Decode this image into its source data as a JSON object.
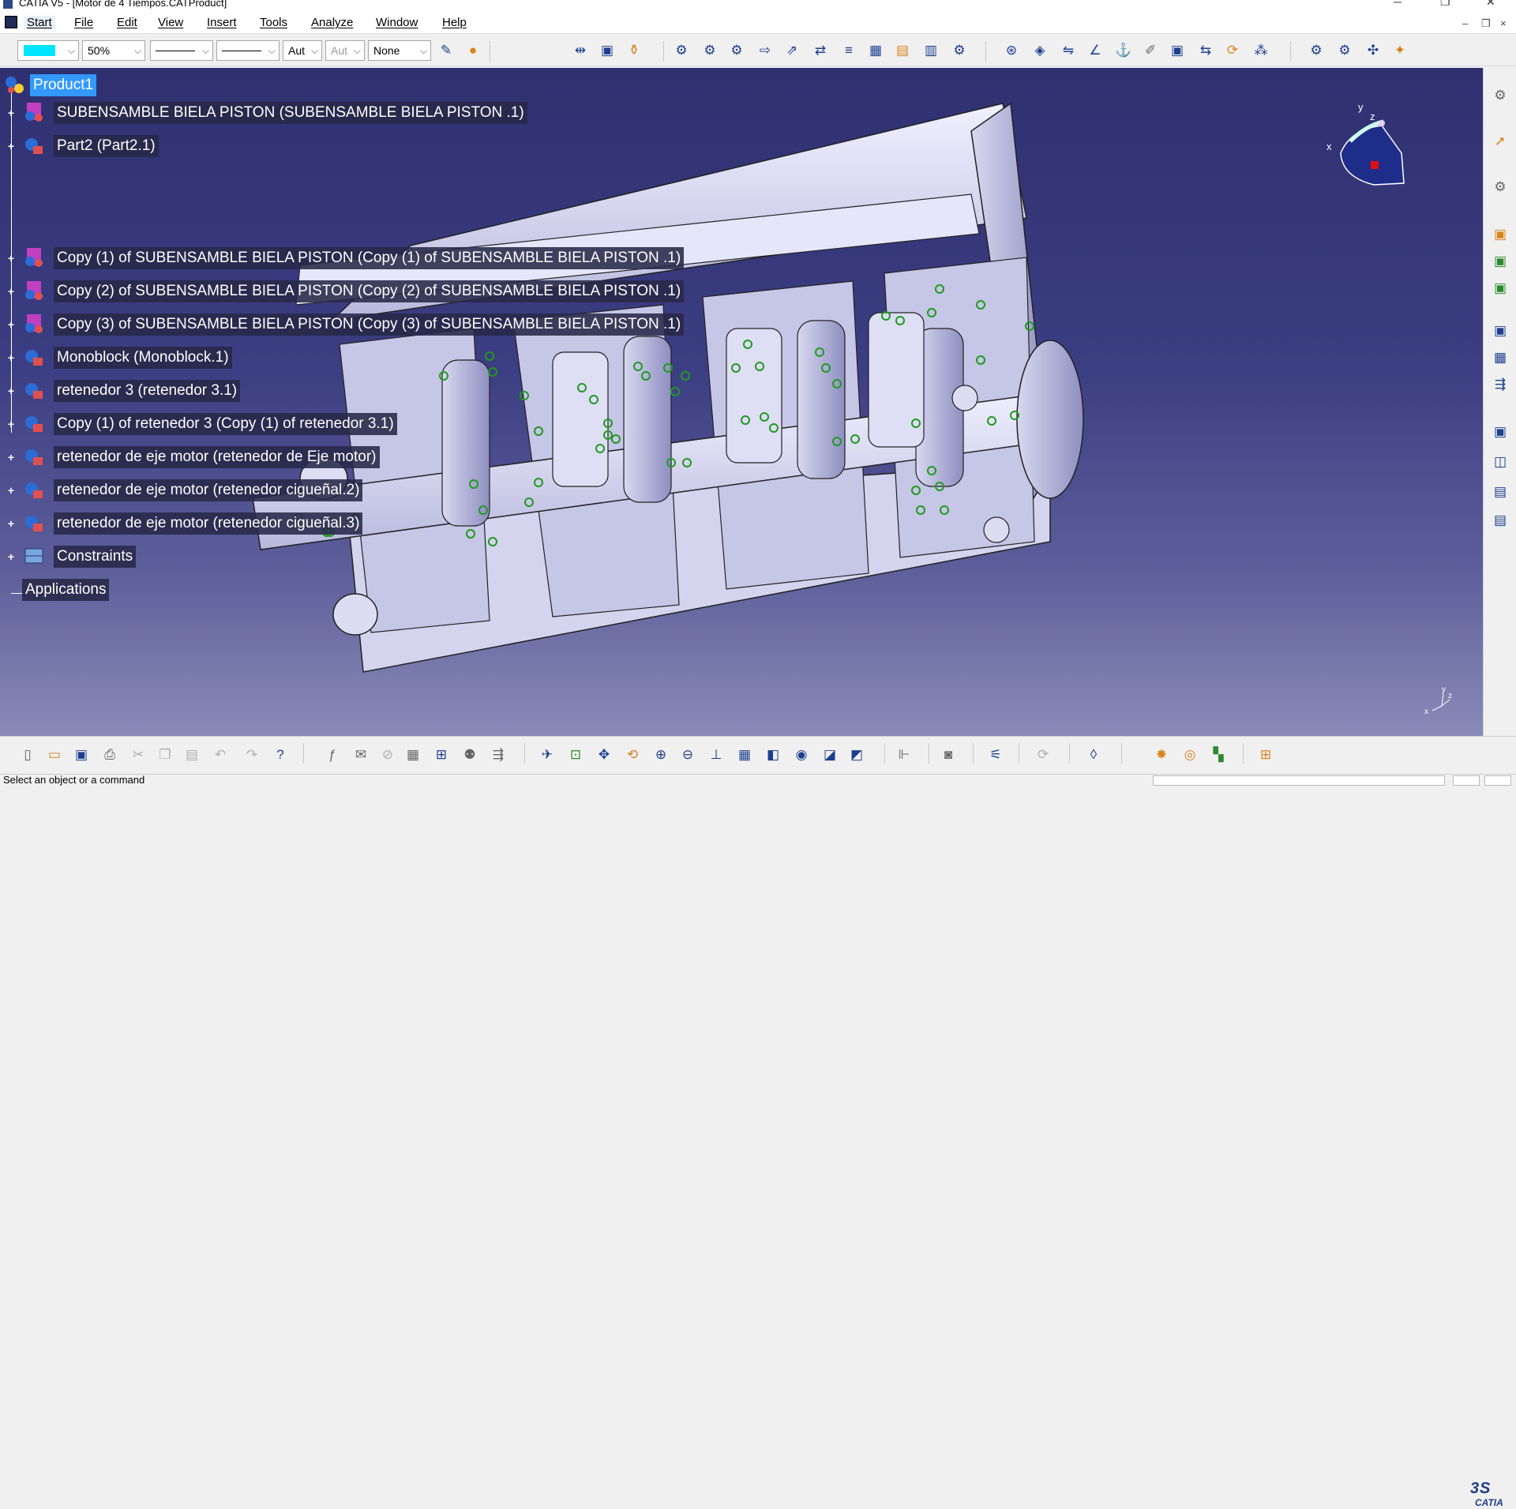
{
  "window": {
    "title": "CATIA V5 - [Motor de 4 Tiempos.CATProduct]",
    "minimize": "─",
    "restore": "❐",
    "close": "✕"
  },
  "menu": {
    "items": [
      "Start",
      "File",
      "Edit",
      "View",
      "Insert",
      "Tools",
      "Analyze",
      "Window",
      "Help"
    ],
    "mdi_minimize": "–",
    "mdi_restore": "❐",
    "mdi_close": "×"
  },
  "toolbar": {
    "zoom": "50%",
    "thickness_value": "Aut",
    "point_value": "Aut",
    "layer_value": "None",
    "combo_arrow": "⌵"
  },
  "tree": {
    "root": "Product1",
    "items": [
      {
        "label": "SUBENSAMBLE BIELA PISTON  (SUBENSAMBLE BIELA PISTON .1)"
      },
      {
        "label": "Part2 (Part2.1)"
      },
      {
        "label": "Copy (1) of SUBENSAMBLE BIELA PISTON  (Copy (1) of SUBENSAMBLE BIELA PISTON .1)"
      },
      {
        "label": "Copy (2) of SUBENSAMBLE BIELA PISTON  (Copy (2) of SUBENSAMBLE BIELA PISTON .1)"
      },
      {
        "label": "Copy (3) of SUBENSAMBLE BIELA PISTON  (Copy (3) of SUBENSAMBLE BIELA PISTON .1)"
      },
      {
        "label": "Monoblock (Monoblock.1)"
      },
      {
        "label": "retenedor 3 (retenedor 3.1)"
      },
      {
        "label": "Copy (1) of retenedor 3 (Copy (1) of retenedor 3.1)"
      },
      {
        "label": "retenedor de eje motor (retenedor de Eje motor)"
      },
      {
        "label": "retenedor de eje motor (retenedor cigueñal.2)"
      },
      {
        "label": "retenedor de eje motor (retenedor cigueñal.3)"
      },
      {
        "label": "Constraints"
      }
    ],
    "applications": "Applications",
    "expander": "+"
  },
  "compass": {
    "x_label": "x",
    "y_label": "y",
    "z_label": "z"
  },
  "axis_indicator": {
    "x": "x",
    "y": "y",
    "z": "z"
  },
  "status": {
    "message": "Select an object or a command"
  },
  "branding": {
    "logo_text": "CATIA"
  },
  "colors": {
    "current_color": "#00e5ff",
    "viewport_top": "#2e3070",
    "viewport_bottom": "#8a8bb8",
    "selection": "#3399ff",
    "constraint_green": "#1f9a1f"
  }
}
